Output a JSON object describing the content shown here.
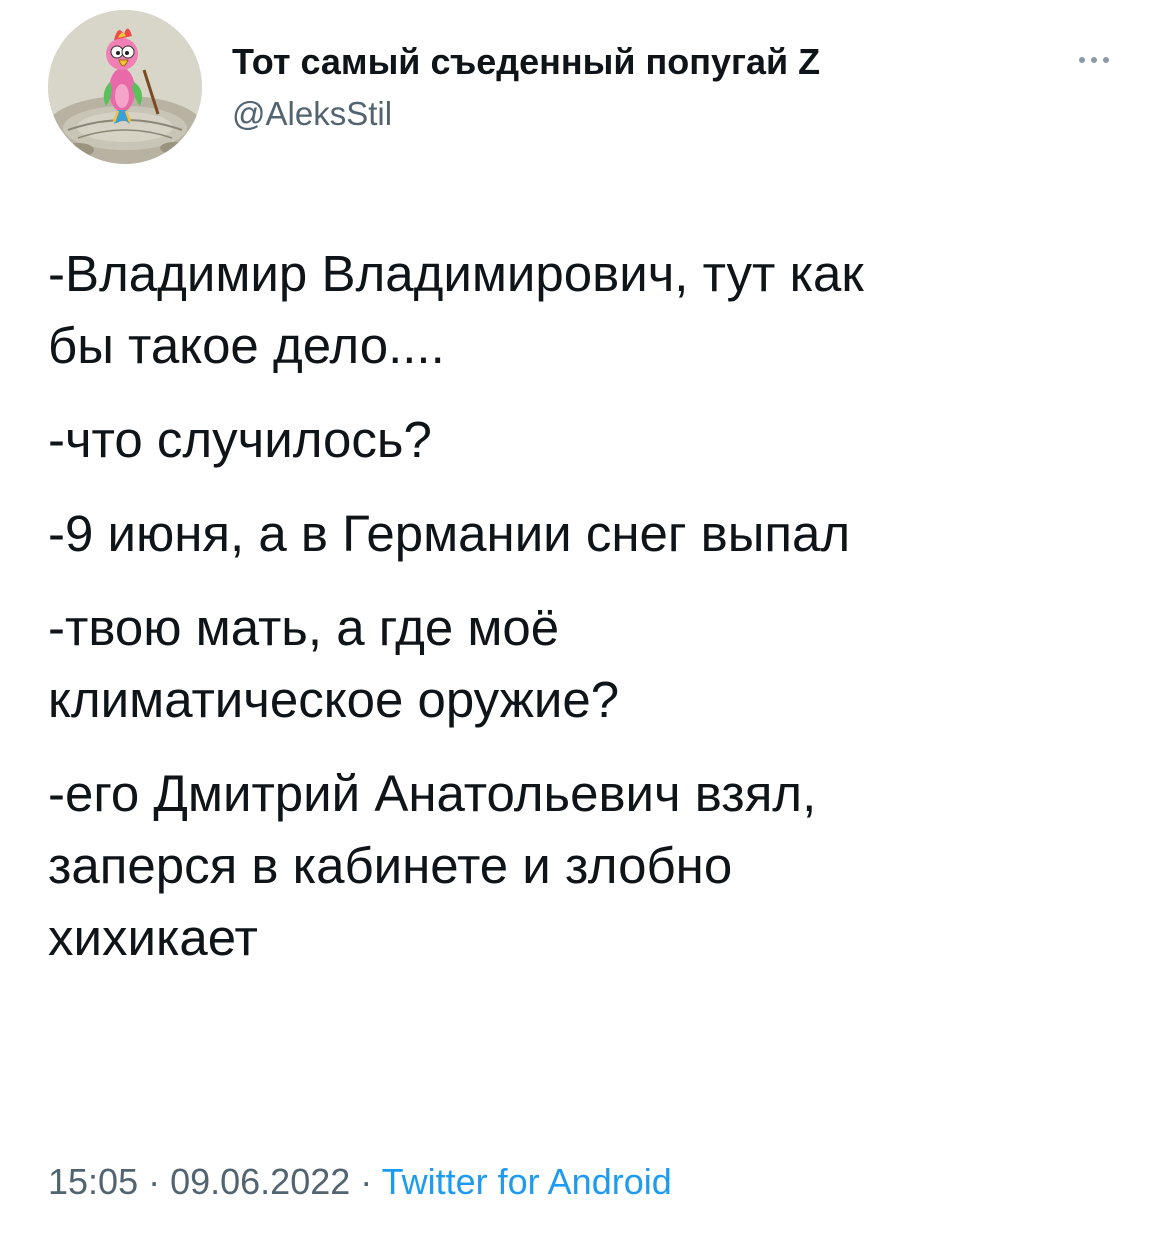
{
  "author": {
    "display_name": "Тот самый съеденный попугай Z",
    "handle": "@AleksStil",
    "avatar_icon": "parrot-avatar-icon"
  },
  "more_icon": "more-options-icon",
  "tweet": {
    "paragraphs": [
      [
        "-Владимир Владимирович,  тут как",
        "бы такое дело...."
      ],
      [
        "-что случилось?"
      ],
      [
        "-9 июня, а в Германии снег выпал"
      ],
      [
        "-твою мать, а где моё",
        "климатическое оружие?"
      ],
      [
        "-его Дмитрий Анатольевич взял,",
        "заперся в кабинете и злобно",
        "хихикает"
      ]
    ]
  },
  "meta": {
    "time": "15:05",
    "separator1": " · ",
    "date": "09.06.2022",
    "separator2": " · ",
    "source": "Twitter for Android"
  },
  "colors": {
    "text": "#0f1419",
    "secondary": "#536471",
    "link": "#1d9bf0"
  }
}
